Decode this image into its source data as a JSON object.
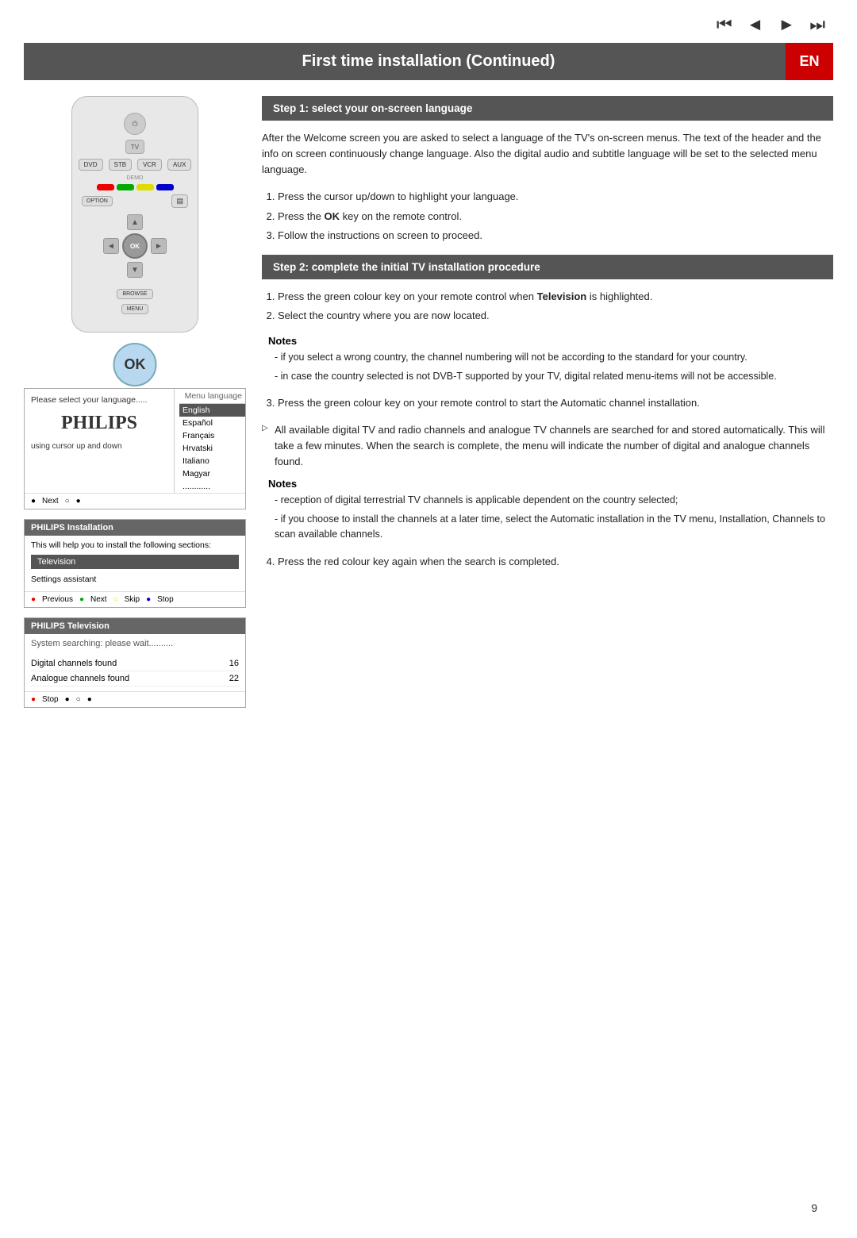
{
  "top_nav": {
    "icons": [
      "skip_back",
      "rewind",
      "fast_forward",
      "skip_forward"
    ]
  },
  "header": {
    "title": "First time installation  (Continued)",
    "badge": "EN"
  },
  "remote": {
    "ok_label": "OK",
    "power_label": "⏻",
    "tv_label": "TV",
    "menu_label": "MENU",
    "browse_label": "BROWSE",
    "option_label": "OPTION"
  },
  "screen1": {
    "col_header": "Menu language",
    "left_label": "Please select your language.....",
    "left_sublabel": "using cursor up and down",
    "languages": [
      {
        "name": "English",
        "selected": true
      },
      {
        "name": "Español",
        "selected": false
      },
      {
        "name": "Français",
        "selected": false
      },
      {
        "name": "Hrvatski",
        "selected": false
      },
      {
        "name": "Italiano",
        "selected": false
      },
      {
        "name": "Magyar",
        "selected": false
      },
      {
        "name": "............",
        "selected": false
      }
    ],
    "footer_btn": "Next"
  },
  "screen2": {
    "header": "PHILIPS  Installation",
    "desc": "This will help you to install the following sections:",
    "selected_item": "Television",
    "sub_item": "Settings assistant",
    "footer_buttons": [
      "Previous",
      "Next",
      "Skip",
      "Stop"
    ]
  },
  "screen3": {
    "header": "PHILIPS  Television",
    "desc": "System searching: please wait..........",
    "rows": [
      {
        "label": "Digital channels found",
        "value": "16"
      },
      {
        "label": "Analogue channels found",
        "value": "22"
      }
    ],
    "footer_btn": "Stop"
  },
  "right_col": {
    "step1": {
      "title": "Step 1: select your on-screen language",
      "body": "After the Welcome screen you are asked to select a language of the TV's on-screen menus. The text of the header and the info on screen continuously change language. Also the digital audio and subtitle language will be set to the selected menu language.",
      "list": [
        "Press the cursor up/down to highlight your language.",
        "Press the <b>OK</b> key on the remote control.",
        "Follow the instructions on screen to proceed."
      ]
    },
    "step2": {
      "title": "Step 2: complete the initial TV installation procedure",
      "list_item1_pre": "Press the green colour key on your remote control when ",
      "list_item1_bold": "Television",
      "list_item1_post": " is highlighted.",
      "list_item2": "Select the country where you are now located.",
      "notes1": {
        "title": "Notes",
        "items": [
          "- if you select a wrong country, the channel numbering will not be according to the standard for your country.",
          "- in case the country selected is not DVB-T supported by your TV,  digital related menu-items will not be accessible."
        ]
      },
      "list_item3": "Press the green colour key on your remote control to start the Automatic channel installation.",
      "bullet1": "All available digital TV and radio channels and analogue TV channels  are searched for and stored automatically. This will take a few minutes. When the search is complete, the menu will indicate the number of digital and analogue channels found.",
      "notes2": {
        "title": "Notes",
        "items": [
          "- reception of digital terrestrial TV channels is applicable dependent on the country selected;",
          "- if you choose to install the channels at a later time, select the Automatic installation in the TV menu, Installation, Channels to scan available channels."
        ]
      },
      "list_item4": "Press the red colour key again when the search is completed."
    }
  },
  "page_number": "9"
}
